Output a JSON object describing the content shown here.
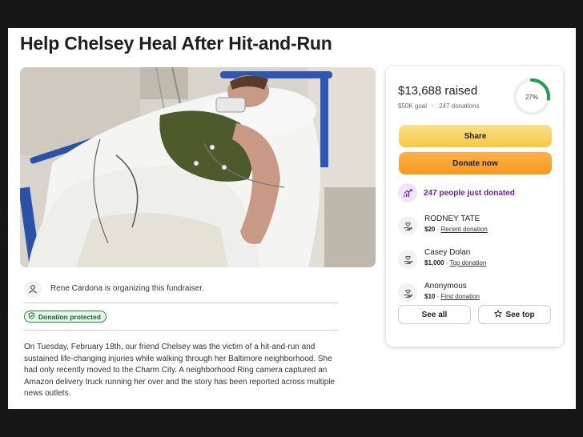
{
  "page": {
    "title": "Help Chelsey Heal After Hit-and-Run"
  },
  "organizer": {
    "icon": "user-icon",
    "text": "Rene Cardona is organizing this fundraiser."
  },
  "protection": {
    "icon": "shield-check-icon",
    "badge": "Donation protected"
  },
  "story": {
    "text": "On Tuesday, February 18th, our friend Chelsey was the victim of a hit-and-run and sustained life-changing injuries while walking through her Baltimore neighborhood. She had only recently moved to the Charm City. A neighborhood Ring camera captured an Amazon delivery truck running her over and the story has been reported across multiple news outlets."
  },
  "donation_card": {
    "raised": "$13,688 raised",
    "goal": "$50K goal",
    "donations": "247 donations",
    "separator": "·",
    "progress_percent": 27,
    "progress_label": "27%",
    "share_label": "Share",
    "donate_label": "Donate now",
    "trend_text": "247 people just donated",
    "donors": [
      {
        "name": "RODNEY TATE",
        "amount": "$20",
        "tag": "Recent donation"
      },
      {
        "name": "Casey Dolan",
        "amount": "$1,000",
        "tag": "Top donation"
      },
      {
        "name": "Anonymous",
        "amount": "$10",
        "tag": "First donation"
      }
    ],
    "see_all_label": "See all",
    "see_top_label": "See top"
  },
  "colors": {
    "progress_green": "#1f9d4a",
    "trend_purple": "#6a1fb3",
    "share_yellow": "#f5c842",
    "donate_orange": "#f79a1e",
    "protected_green": "#1f8a3a"
  }
}
